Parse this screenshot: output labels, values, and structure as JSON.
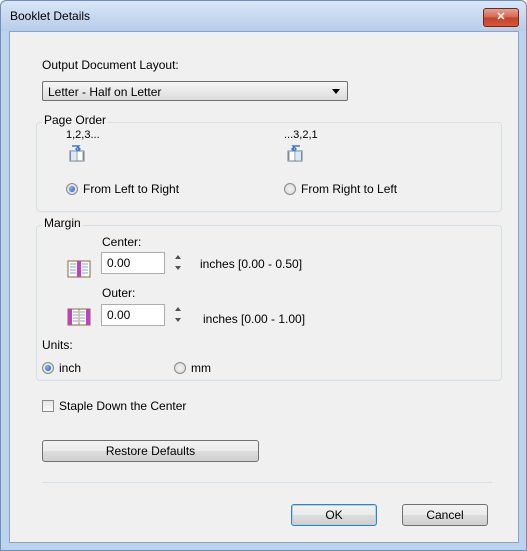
{
  "window": {
    "title": "Booklet Details",
    "close_glyph": "✕"
  },
  "layout": {
    "label": "Output Document Layout:",
    "selected": "Letter - Half on Letter"
  },
  "page_order": {
    "title": "Page Order",
    "ltr": {
      "sequence": "1,2,3...",
      "label": "From Left to Right",
      "checked": true
    },
    "rtl": {
      "sequence": "...3,2,1",
      "label": "From Right to Left",
      "checked": false
    }
  },
  "margin": {
    "title": "Margin",
    "center": {
      "label": "Center:",
      "value": "0.00",
      "range": "inches [0.00 - 0.50]"
    },
    "outer": {
      "label": "Outer:",
      "value": "0.00",
      "range": "inches [0.00 - 1.00]"
    },
    "units": {
      "label": "Units:",
      "inch": {
        "label": "inch",
        "checked": true
      },
      "mm": {
        "label": "mm",
        "checked": false
      }
    }
  },
  "staple": {
    "label": "Staple Down the Center",
    "checked": false
  },
  "buttons": {
    "restore": "Restore Defaults",
    "ok": "OK",
    "cancel": "Cancel"
  },
  "colors": {
    "accent": "#1f5ebc",
    "close": "#c2412a",
    "margin_icon": "#c040c0"
  }
}
